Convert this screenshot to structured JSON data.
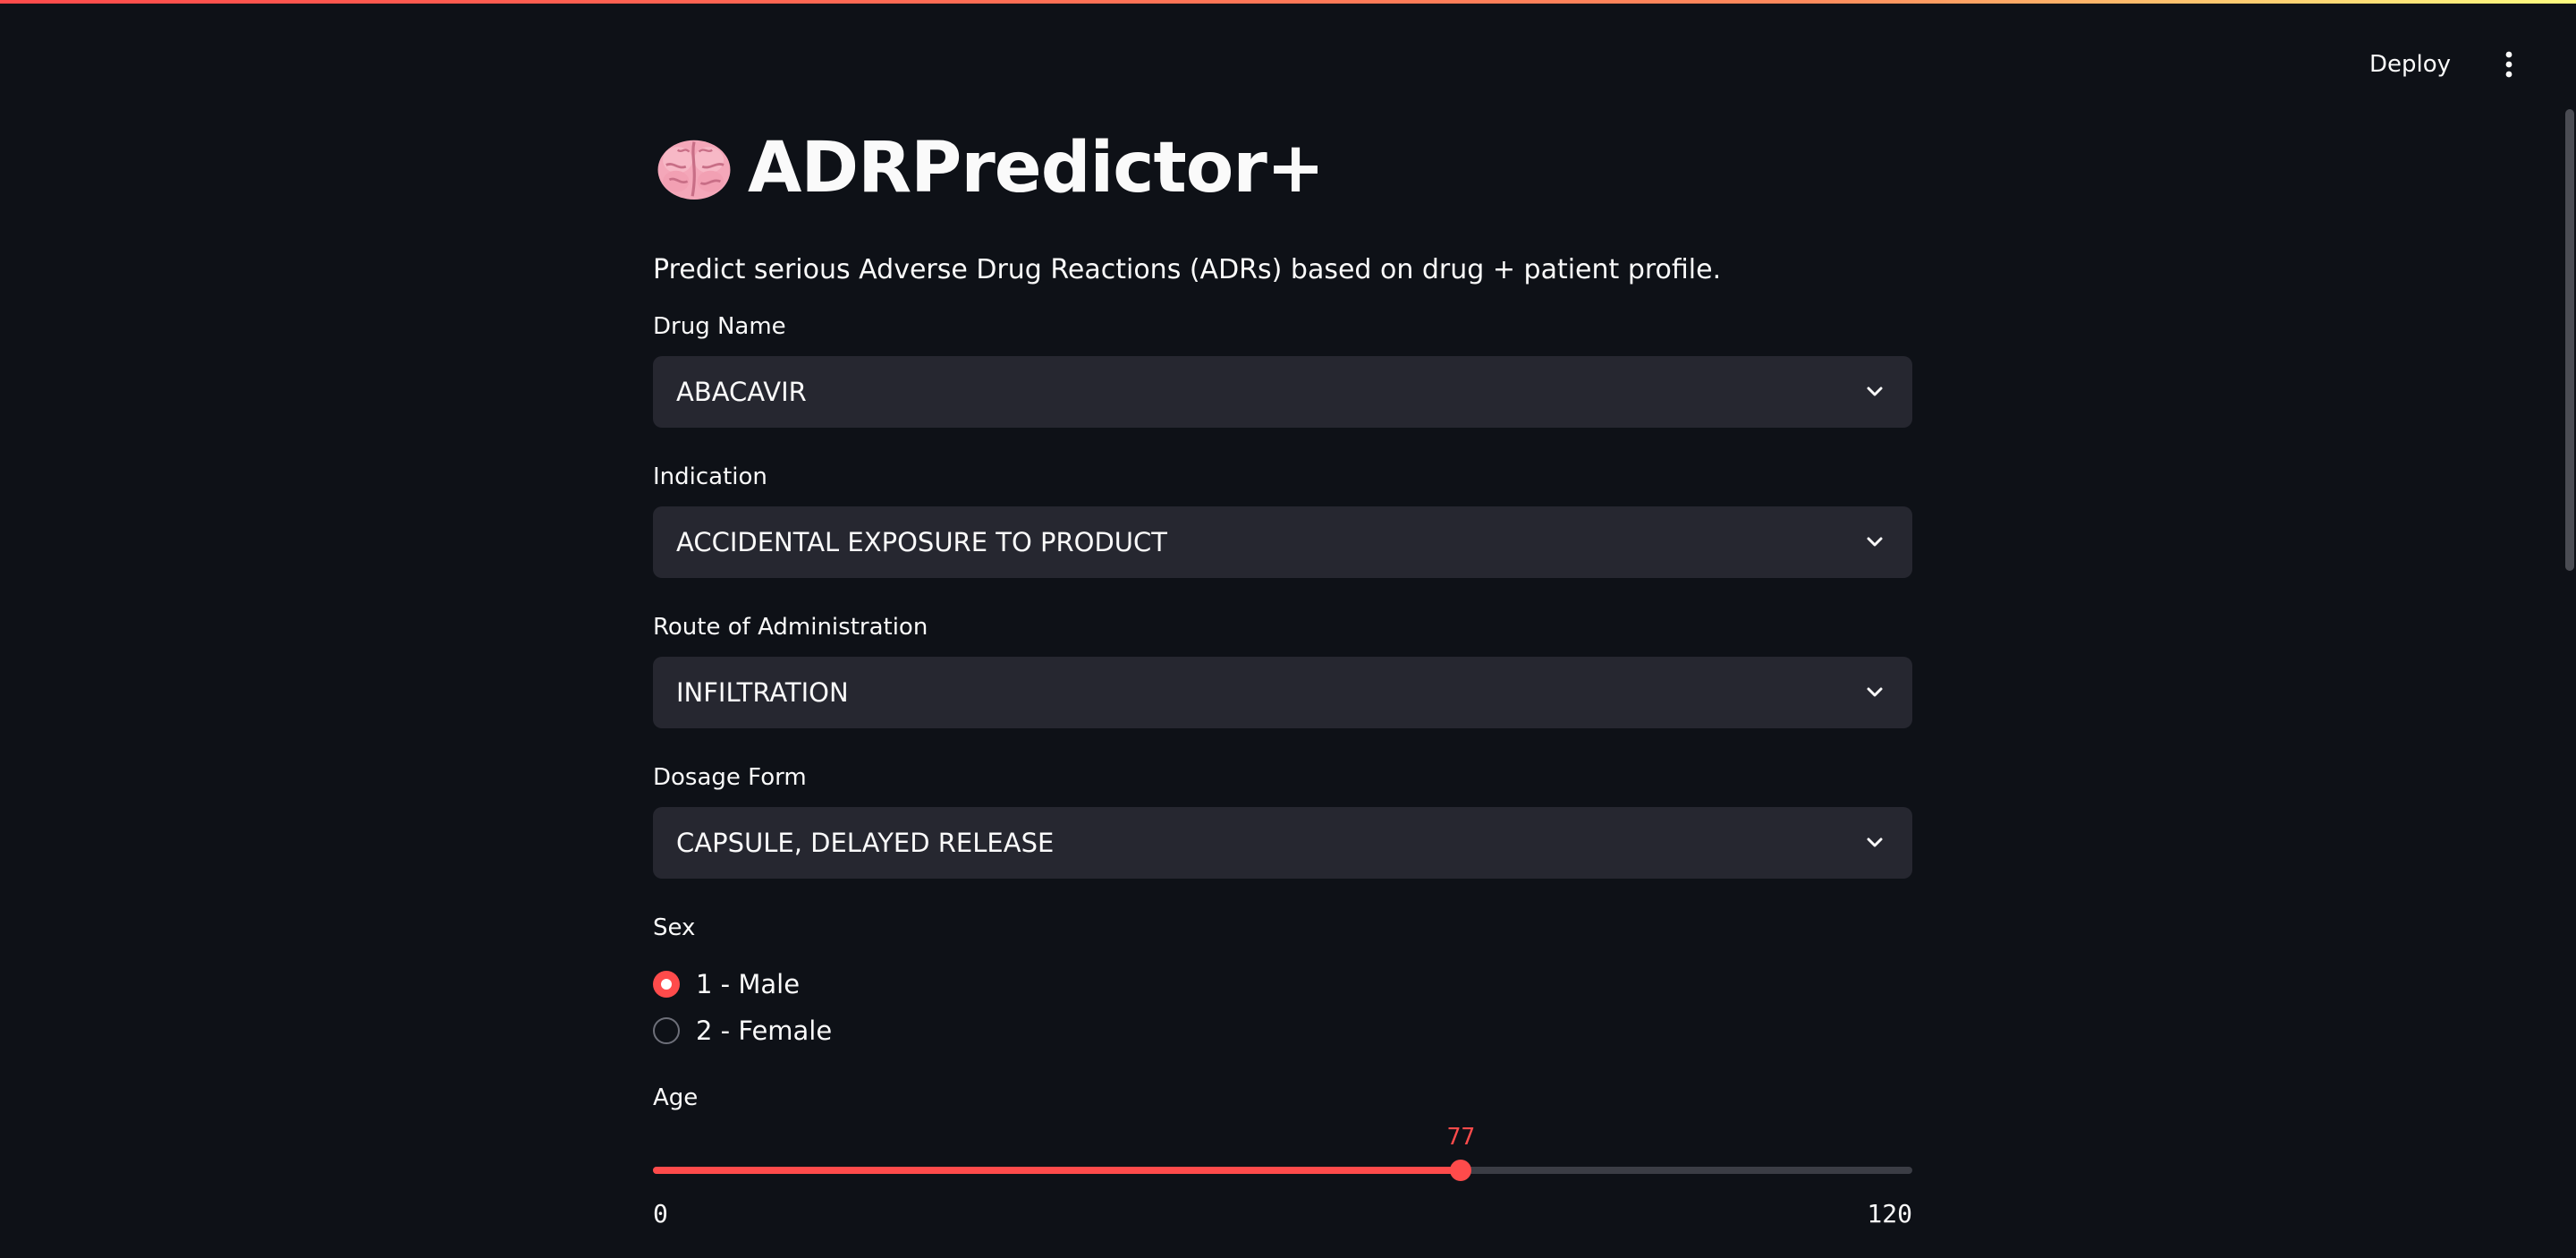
{
  "toolbar": {
    "deploy_label": "Deploy",
    "menu_icon": "more-vertical-icon"
  },
  "app": {
    "title": "ADRPredictor+",
    "title_icon": "brain-icon",
    "subtitle": "Predict serious Adverse Drug Reactions (ADRs) based on drug + patient profile."
  },
  "form": {
    "drug_name": {
      "label": "Drug Name",
      "value": "ABACAVIR"
    },
    "indication": {
      "label": "Indication",
      "value": "ACCIDENTAL EXPOSURE TO PRODUCT"
    },
    "route": {
      "label": "Route of Administration",
      "value": "INFILTRATION"
    },
    "dosage_form": {
      "label": "Dosage Form",
      "value": "CAPSULE, DELAYED RELEASE"
    },
    "sex": {
      "label": "Sex",
      "options": [
        {
          "label": "1 - Male",
          "selected": true
        },
        {
          "label": "2 - Female",
          "selected": false
        }
      ]
    },
    "age": {
      "label": "Age",
      "value": "77",
      "min": "0",
      "max": "120"
    }
  },
  "colors": {
    "accent": "#ff4b4b",
    "background": "#0e1117",
    "input_background": "#262730"
  }
}
